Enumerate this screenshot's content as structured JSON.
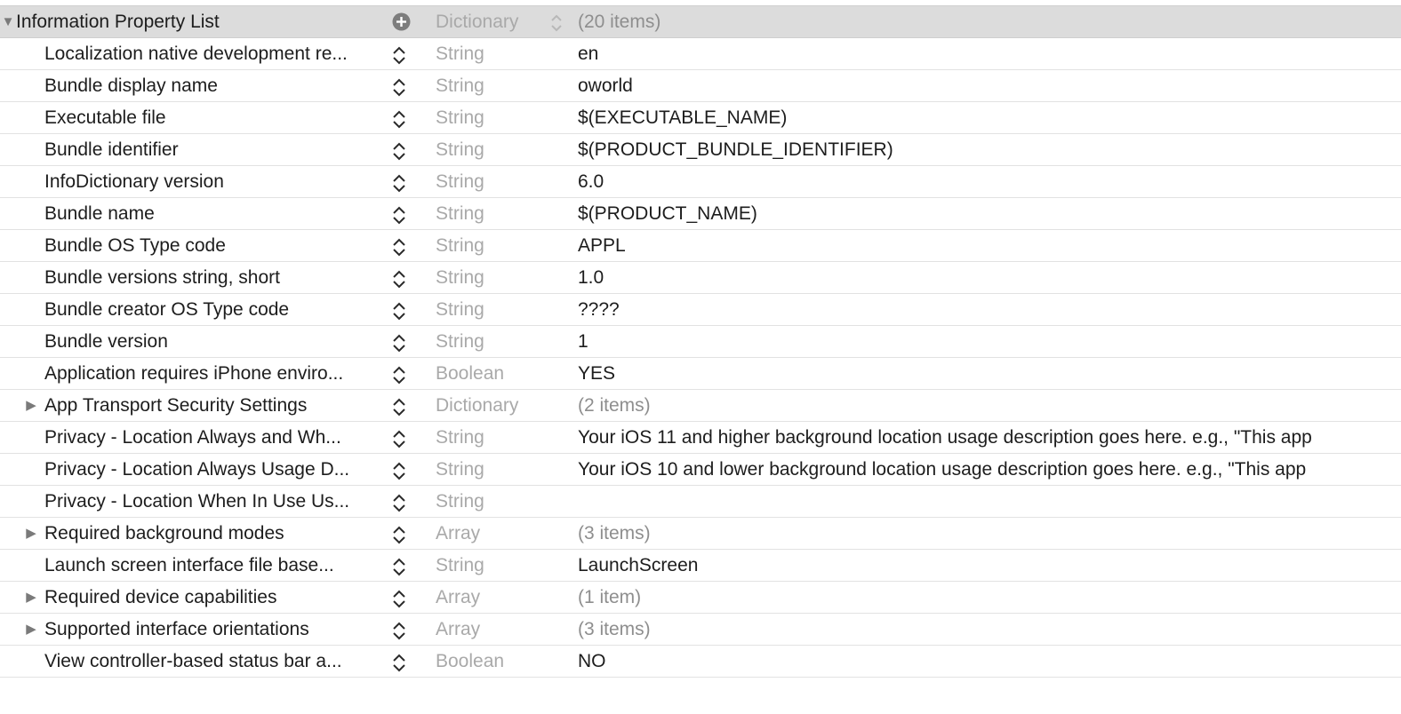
{
  "root": {
    "key": "Information Property List",
    "type": "Dictionary",
    "value": "(20 items)",
    "icons": {
      "disclosure": "triangle-down",
      "add": "plus-circle",
      "type_stepper": "up-down-chevron"
    }
  },
  "rows": [
    {
      "key": "Localization native development re...",
      "type": "String",
      "value": "en",
      "expandable": false
    },
    {
      "key": "Bundle display name",
      "type": "String",
      "value": "oworld",
      "expandable": false
    },
    {
      "key": "Executable file",
      "type": "String",
      "value": "$(EXECUTABLE_NAME)",
      "expandable": false
    },
    {
      "key": "Bundle identifier",
      "type": "String",
      "value": "$(PRODUCT_BUNDLE_IDENTIFIER)",
      "expandable": false
    },
    {
      "key": "InfoDictionary version",
      "type": "String",
      "value": "6.0",
      "expandable": false
    },
    {
      "key": "Bundle name",
      "type": "String",
      "value": "$(PRODUCT_NAME)",
      "expandable": false
    },
    {
      "key": "Bundle OS Type code",
      "type": "String",
      "value": "APPL",
      "expandable": false
    },
    {
      "key": "Bundle versions string, short",
      "type": "String",
      "value": "1.0",
      "expandable": false
    },
    {
      "key": "Bundle creator OS Type code",
      "type": "String",
      "value": "????",
      "expandable": false
    },
    {
      "key": "Bundle version",
      "type": "String",
      "value": "1",
      "expandable": false
    },
    {
      "key": "Application requires iPhone enviro...",
      "type": "Boolean",
      "value": "YES",
      "expandable": false
    },
    {
      "key": "App Transport Security Settings",
      "type": "Dictionary",
      "value": "(2 items)",
      "expandable": true
    },
    {
      "key": "Privacy - Location Always and Wh...",
      "type": "String",
      "value": "Your iOS 11 and higher background location usage description goes here. e.g., \"This app",
      "expandable": false
    },
    {
      "key": "Privacy - Location Always Usage D...",
      "type": "String",
      "value": "Your iOS 10 and lower background location usage description goes here. e.g., \"This app",
      "expandable": false
    },
    {
      "key": "Privacy - Location When In Use Us...",
      "type": "String",
      "value": "",
      "expandable": false
    },
    {
      "key": "Required background modes",
      "type": "Array",
      "value": "(3 items)",
      "expandable": true
    },
    {
      "key": "Launch screen interface file base...",
      "type": "String",
      "value": "LaunchScreen",
      "expandable": false
    },
    {
      "key": "Required device capabilities",
      "type": "Array",
      "value": "(1 item)",
      "expandable": true
    },
    {
      "key": "Supported interface orientations",
      "type": "Array",
      "value": "(3 items)",
      "expandable": true
    },
    {
      "key": "View controller-based status bar a...",
      "type": "Boolean",
      "value": "NO",
      "expandable": false
    }
  ],
  "colors": {
    "root_background": "#dcdcdc",
    "row_divider": "#e2e2e2",
    "type_text": "#a9a9a9",
    "count_text": "#8e8e8e"
  }
}
